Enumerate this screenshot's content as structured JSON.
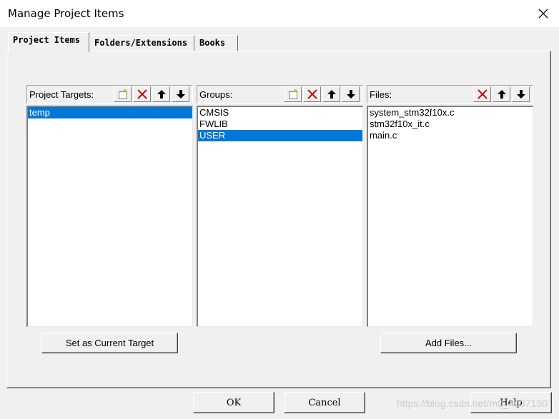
{
  "window": {
    "title": "Manage Project Items",
    "close_glyph": "✕"
  },
  "tabs": [
    {
      "label": "Project Items",
      "active": true
    },
    {
      "label": "Folders/Extensions",
      "active": false
    },
    {
      "label": "Books",
      "active": false
    }
  ],
  "targets": {
    "label": "Project Targets:",
    "items": [
      {
        "label": "temp",
        "selected": true
      }
    ],
    "toolbar": [
      "new-icon",
      "delete-icon",
      "move-up-icon",
      "move-down-icon"
    ]
  },
  "groups": {
    "label": "Groups:",
    "items": [
      {
        "label": "CMSIS",
        "selected": false
      },
      {
        "label": "FWLIB",
        "selected": false
      },
      {
        "label": "USER",
        "selected": true
      }
    ],
    "toolbar": [
      "new-icon",
      "delete-icon",
      "move-up-icon",
      "move-down-icon"
    ]
  },
  "files": {
    "label": "Files:",
    "items": [
      {
        "label": "system_stm32f10x.c",
        "selected": false
      },
      {
        "label": "stm32f10x_it.c",
        "selected": false
      },
      {
        "label": "main.c",
        "selected": false
      }
    ],
    "toolbar": [
      "delete-icon",
      "move-up-icon",
      "move-down-icon"
    ]
  },
  "buttons": {
    "set_current_target": "Set as Current Target",
    "add_files": "Add Files...",
    "ok": "OK",
    "cancel": "Cancel",
    "help": "Help"
  },
  "watermark": "https://blog.csdn.net/m0_4637150",
  "colors": {
    "selection": "#0078d7",
    "delete_red": "#e00000",
    "new_yellow": "#f0e040"
  }
}
